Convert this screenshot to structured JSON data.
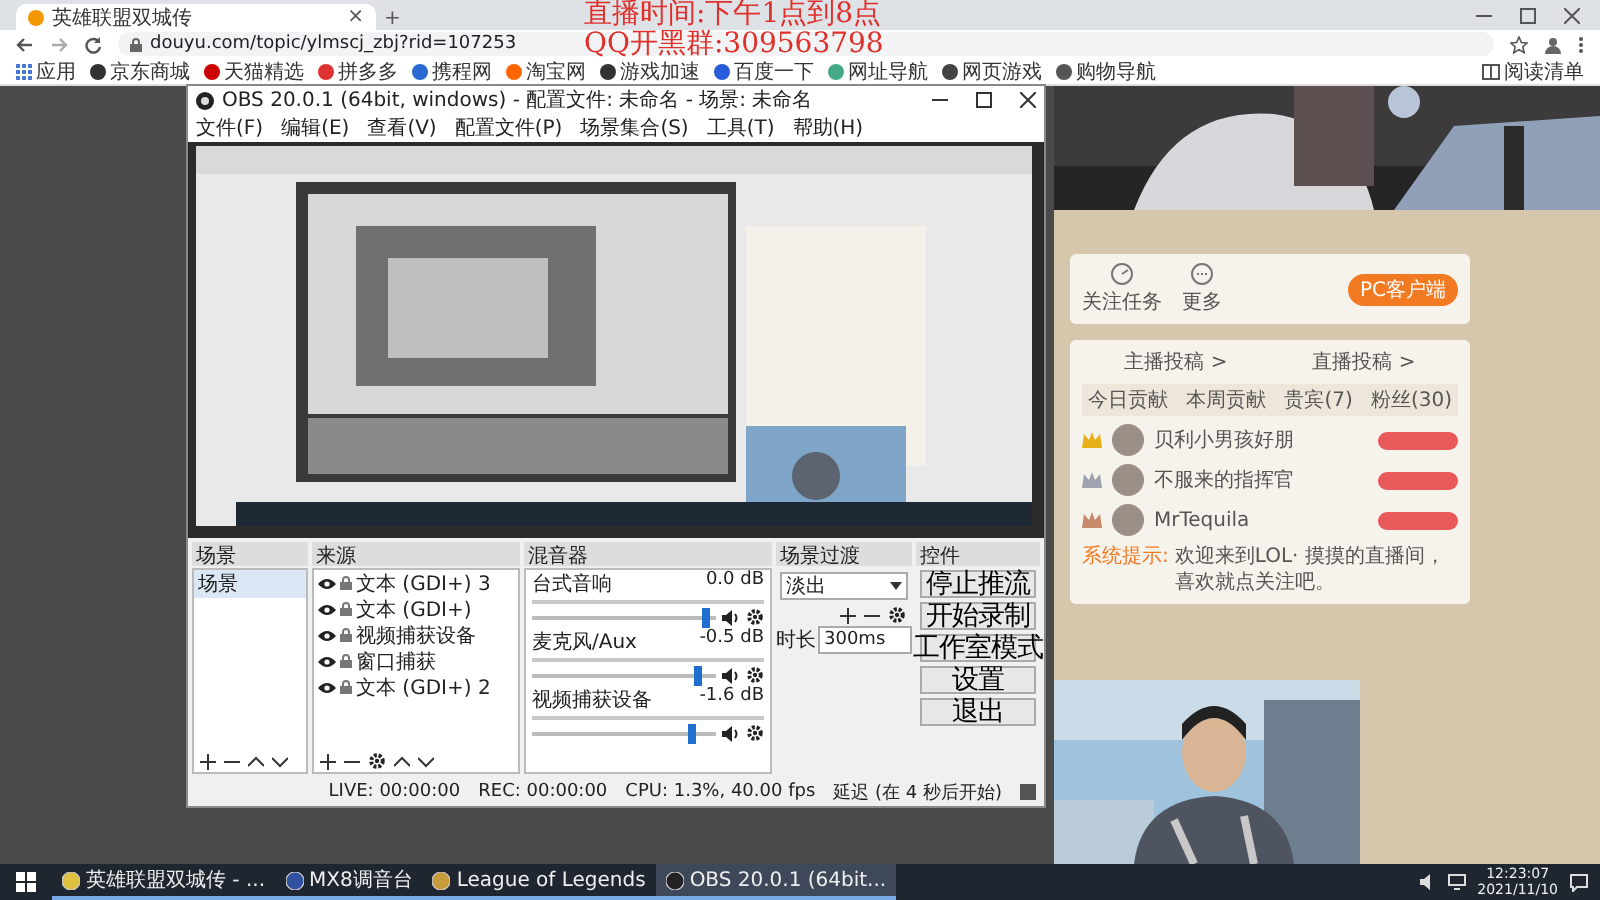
{
  "browser": {
    "tab_title": "英雄联盟双城传",
    "tab_close": "×",
    "new_tab": "+",
    "url": "douyu.com/topic/ylmscj_zbj?rid=107253",
    "bookmarks": [
      "应用",
      "京东商城",
      "天猫精选",
      "拼多多",
      "携程网",
      "淘宝网",
      "游戏加速",
      "百度一下",
      "网址导航",
      "网页游戏",
      "购物导航"
    ],
    "reading_list": "阅读清单"
  },
  "overlay": [
    "直播时间:下午1点到8点",
    "QQ开黑群:309563798"
  ],
  "page": {
    "tools": [
      "关注任务",
      "更多"
    ],
    "client_button": "PC客户端",
    "links": [
      "主播投稿 >",
      "直播投稿 >"
    ],
    "rank_columns": [
      "今日贡献",
      "本周贡献",
      "贵宾(7)",
      "粉丝(30)"
    ],
    "rank": [
      {
        "name": "贝利小男孩好朋",
        "color": "#e8b018"
      },
      {
        "name": "不服来的指挥官",
        "color": "#a0a4b0"
      },
      {
        "name": "MrTequila",
        "color": "#c88a6a"
      }
    ],
    "notice_label": "系统提示:",
    "notice": "欢迎来到LOL· 摸摸的直播间，喜欢就点关注吧。"
  },
  "obs": {
    "title": "OBS 20.0.1 (64bit, windows) - 配置文件: 未命名 - 场景: 未命名",
    "menu": [
      "文件(F)",
      "编辑(E)",
      "查看(V)",
      "配置文件(P)",
      "场景集合(S)",
      "工具(T)",
      "帮助(H)"
    ],
    "scenes_title": "场景",
    "scenes": [
      {
        "name": "场景",
        "selected": true
      }
    ],
    "sources_title": "来源",
    "sources": [
      "文本 (GDI+) 3",
      "文本 (GDI+)",
      "视频捕获设备",
      "窗口捕获",
      "文本 (GDI+) 2"
    ],
    "mixer_title": "混音器",
    "mixer": [
      {
        "name": "台式音响",
        "reading": "0.0 dB",
        "level": 0.95
      },
      {
        "name": "麦克风/Aux",
        "reading": "-0.5 dB",
        "level": 0.9
      },
      {
        "name": "视频捕获设备",
        "reading": "-1.6 dB",
        "level": 0.87
      }
    ],
    "transitions_title": "场景过渡",
    "transition": "淡出",
    "duration_label": "时长",
    "duration": "300ms",
    "controls_title": "控件",
    "controls": [
      "停止推流",
      "开始录制",
      "工作室模式",
      "设置",
      "退出"
    ],
    "status": [
      "LIVE: 00:00:00",
      "REC: 00:00:00",
      "CPU: 1.3%, 40.00 fps",
      "延迟 (在 4 秒后开始)"
    ]
  },
  "taskbar": {
    "items": [
      {
        "label": "英雄联盟双城传 - ...",
        "selected": false
      },
      {
        "label": "MX8调音台",
        "selected": false
      },
      {
        "label": "League of Legends",
        "selected": false
      },
      {
        "label": "OBS 20.0.1 (64bit...",
        "selected": true
      }
    ],
    "time": "12:23:07",
    "date": "2021/11/10"
  }
}
